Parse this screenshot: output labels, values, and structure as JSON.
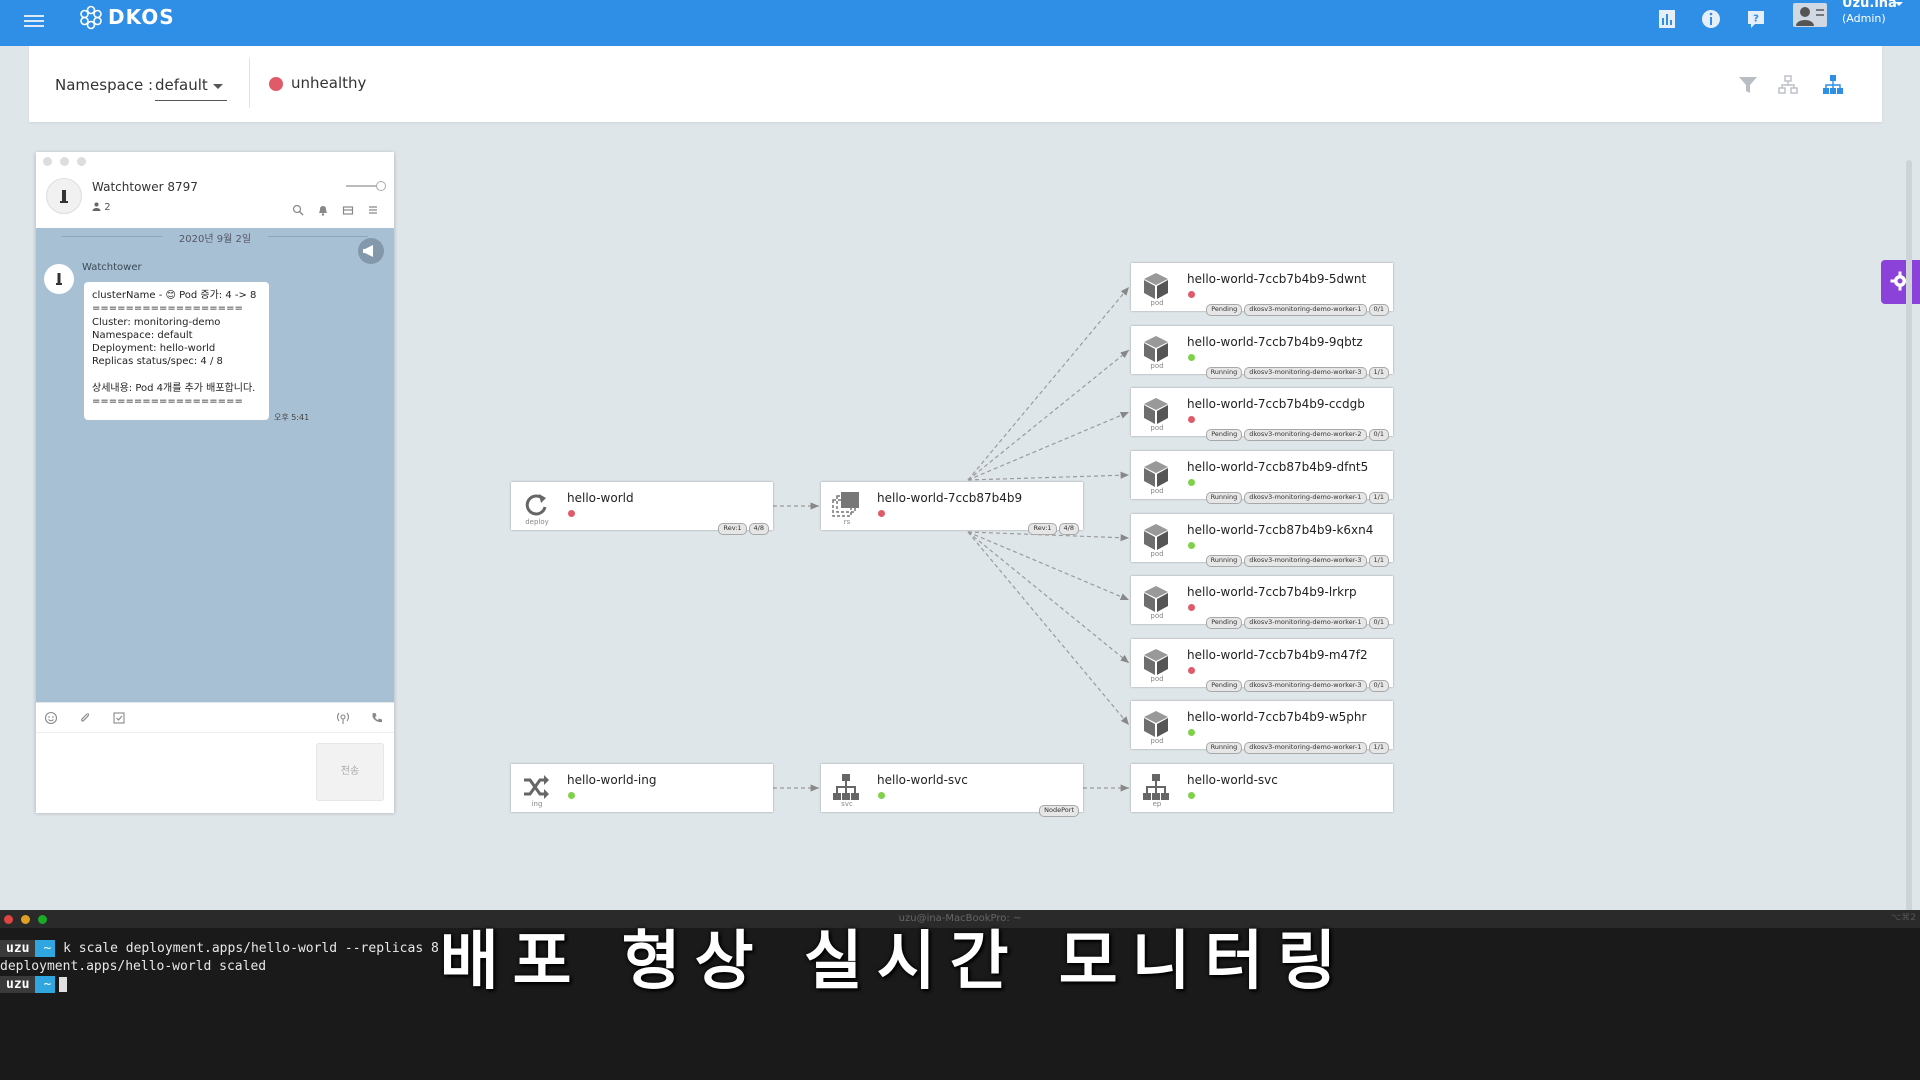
{
  "app": {
    "logo": "DKOS"
  },
  "user": {
    "name": "Uzu.ina",
    "role": "(Admin)"
  },
  "filter": {
    "namespace_label": "Namespace :",
    "namespace_value": "default",
    "health": "unhealthy"
  },
  "chat": {
    "title": "Watchtower 8797",
    "members": "2",
    "date": "2020년 9월 2일",
    "sender": "Watchtower",
    "message": {
      "line1": "clusterName - 😊 Pod 증가: 4 -> 8",
      "sep1": "==================",
      "cluster": "Cluster: monitoring-demo",
      "namespace": "Namespace: default",
      "deployment": "Deployment: hello-world",
      "replicas": "Replicas status/spec: 4 / 8",
      "detail": "상세내용: Pod 4개를 추가 배포합니다.",
      "sep2": "=================="
    },
    "time": "오후 5:41",
    "send_label": "전송"
  },
  "topology": {
    "deploy": {
      "name": "hello-world",
      "kind": "deploy",
      "tags": [
        "Rev:1",
        "4/8"
      ]
    },
    "rs": {
      "name": "hello-world-7ccb87b4b9",
      "kind": "rs",
      "tags": [
        "Rev:1",
        "4/8"
      ]
    },
    "ing": {
      "name": "hello-world-ing",
      "kind": "ing"
    },
    "svc": {
      "name": "hello-world-svc",
      "kind": "svc",
      "tags": [
        "NodePort"
      ]
    },
    "ep": {
      "name": "hello-world-svc",
      "kind": "ep"
    },
    "pods": [
      {
        "name": "hello-world-7ccb7b4b9-5dwnt",
        "kind": "pod",
        "status": "Pending",
        "node": "dkosv3-monitoring-demo-worker-1",
        "ready": "0/1"
      },
      {
        "name": "hello-world-7ccb7b4b9-9qbtz",
        "kind": "pod",
        "status": "Running",
        "node": "dkosv3-monitoring-demo-worker-3",
        "ready": "1/1"
      },
      {
        "name": "hello-world-7ccb7b4b9-ccdgb",
        "kind": "pod",
        "status": "Pending",
        "node": "dkosv3-monitoring-demo-worker-2",
        "ready": "0/1"
      },
      {
        "name": "hello-world-7ccb87b4b9-dfnt5",
        "kind": "pod",
        "status": "Running",
        "node": "dkosv3-monitoring-demo-worker-1",
        "ready": "1/1"
      },
      {
        "name": "hello-world-7ccb87b4b9-k6xn4",
        "kind": "pod",
        "status": "Running",
        "node": "dkosv3-monitoring-demo-worker-3",
        "ready": "1/1"
      },
      {
        "name": "hello-world-7ccb7b4b9-lrkrp",
        "kind": "pod",
        "status": "Pending",
        "node": "dkosv3-monitoring-demo-worker-1",
        "ready": "0/1"
      },
      {
        "name": "hello-world-7ccb7b4b9-m47f2",
        "kind": "pod",
        "status": "Pending",
        "node": "dkosv3-monitoring-demo-worker-3",
        "ready": "0/1"
      },
      {
        "name": "hello-world-7ccb7b4b9-w5phr",
        "kind": "pod",
        "status": "Running",
        "node": "dkosv3-monitoring-demo-worker-1",
        "ready": "1/1"
      }
    ]
  },
  "terminal": {
    "title": "uzu@ina-MacBookPro: ~",
    "shortcut": "⌥⌘2",
    "prompt_user": "uzu",
    "prompt_dir": "~",
    "command": "k scale deployment.apps/hello-world --replicas 8",
    "output": "deployment.apps/hello-world scaled"
  },
  "caption": "배포 형상 실시간 모니터링",
  "colors": {
    "topbar": "#2f8ee6",
    "unhealthy": "#e05a6a",
    "healthy": "#7fd14a",
    "gear_tab": "#8a42d8"
  }
}
